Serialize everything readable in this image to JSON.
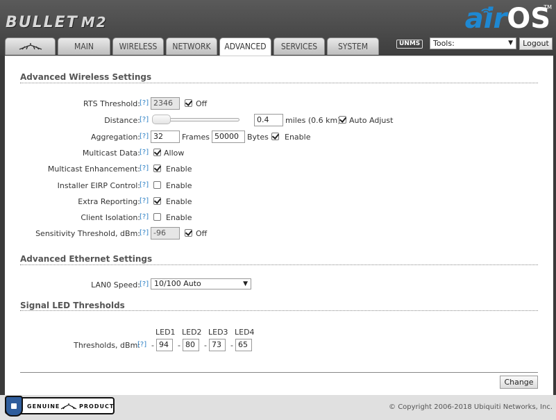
{
  "header": {
    "brand": "BULLET",
    "model": "M2",
    "os_air": "air",
    "os_os": "OS",
    "os_tm": "TM"
  },
  "tabs": [
    {
      "label": "",
      "icon": "ubiquiti-logo-icon"
    },
    {
      "label": "MAIN"
    },
    {
      "label": "WIRELESS"
    },
    {
      "label": "NETWORK"
    },
    {
      "label": "ADVANCED",
      "active": true
    },
    {
      "label": "SERVICES"
    },
    {
      "label": "SYSTEM"
    }
  ],
  "toolbar": {
    "unms": "UNMS",
    "tools_value": "Tools:",
    "logout": "Logout"
  },
  "help": "[?]",
  "wireless": {
    "title": "Advanced Wireless Settings",
    "rts": {
      "label": "RTS Threshold:",
      "value": "2346",
      "check_label": "Off",
      "checked": true
    },
    "distance": {
      "label": "Distance:",
      "value": "0.4",
      "unit": "miles (0.6 km)",
      "check_label": "Auto Adjust",
      "checked": true
    },
    "aggregation": {
      "label": "Aggregation:",
      "frames_value": "32",
      "frames_unit": "Frames",
      "bytes_value": "50000",
      "bytes_unit": "Bytes",
      "check_label": "Enable",
      "checked": true
    },
    "multicast": {
      "label": "Multicast Data:",
      "check_label": "Allow",
      "checked": true
    },
    "multicast_enh": {
      "label": "Multicast Enhancement:",
      "check_label": "Enable",
      "checked": true
    },
    "eirp": {
      "label": "Installer EIRP Control:",
      "check_label": "Enable",
      "checked": false
    },
    "extra": {
      "label": "Extra Reporting:",
      "check_label": "Enable",
      "checked": true
    },
    "isolation": {
      "label": "Client Isolation:",
      "check_label": "Enable",
      "checked": false
    },
    "sensitivity": {
      "label": "Sensitivity Threshold, dBm:",
      "value": "-96",
      "check_label": "Off",
      "checked": true
    }
  },
  "ethernet": {
    "title": "Advanced Ethernet Settings",
    "lan0": {
      "label": "LAN0 Speed:",
      "value": "10/100 Auto"
    }
  },
  "led": {
    "title": "Signal LED Thresholds",
    "label": "Thresholds, dBm:",
    "heads": [
      "LED1",
      "LED2",
      "LED3",
      "LED4"
    ],
    "values": [
      "94",
      "80",
      "73",
      "65"
    ],
    "dash": "-"
  },
  "change_label": "Change",
  "footer": {
    "genuine": "GENUINE",
    "product": "PRODUCT",
    "copyright": "© Copyright 2006-2018 Ubiquiti Networks, Inc."
  }
}
